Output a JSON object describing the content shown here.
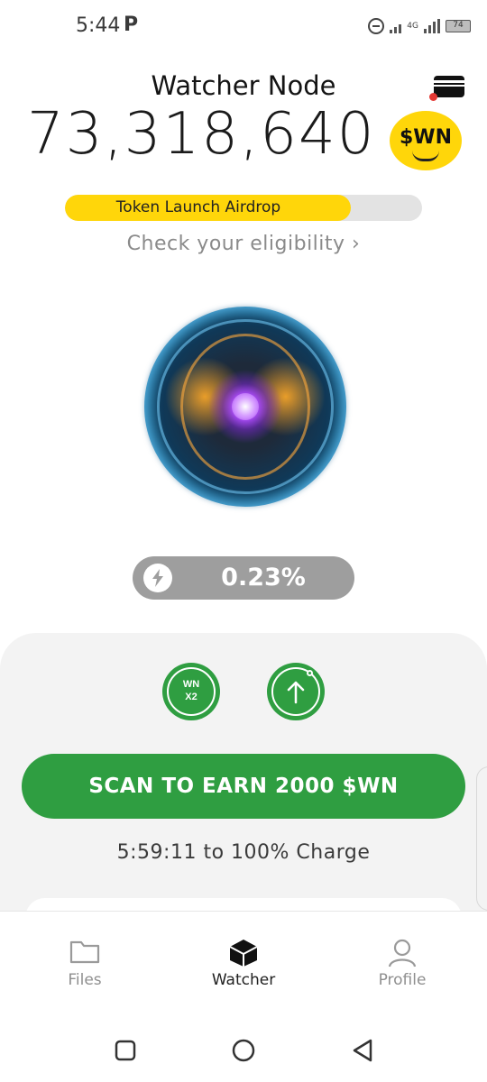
{
  "status_bar": {
    "time": "5:44",
    "carrier_glyph": "P",
    "network_label": "4G",
    "battery": "74"
  },
  "header": {
    "title": "Watcher Node",
    "wallet_icon": "wallet-icon",
    "notification_color": "#e53935"
  },
  "balance": {
    "amount": "73,318,640",
    "token_badge": "$WN"
  },
  "airdrop": {
    "label": "Token Launch Airdrop",
    "progress": 0.8,
    "fill_color": "#ffd60a",
    "eligibility_link": "Check your eligibility ›"
  },
  "node": {
    "image": "watcher-orb",
    "charge_percent": "0.23%",
    "charge_icon": "bolt-icon"
  },
  "actions": {
    "boost_wn": "WN",
    "boost_multiplier": "X2",
    "upgrade_icon": "arrow-up-circle-icon",
    "scan_button": "SCAN TO EARN 2000 $WN",
    "countdown": "5:59:11 to 100% Charge",
    "accent_color": "#2f9e41"
  },
  "nav": {
    "items": [
      {
        "label": "Files",
        "icon": "folder-icon",
        "active": false
      },
      {
        "label": "Watcher",
        "icon": "cube-icon",
        "active": true
      },
      {
        "label": "Profile",
        "icon": "person-icon",
        "active": false
      }
    ]
  },
  "system_nav": {
    "recents": "recents-icon",
    "home": "home-icon",
    "back": "back-icon"
  }
}
